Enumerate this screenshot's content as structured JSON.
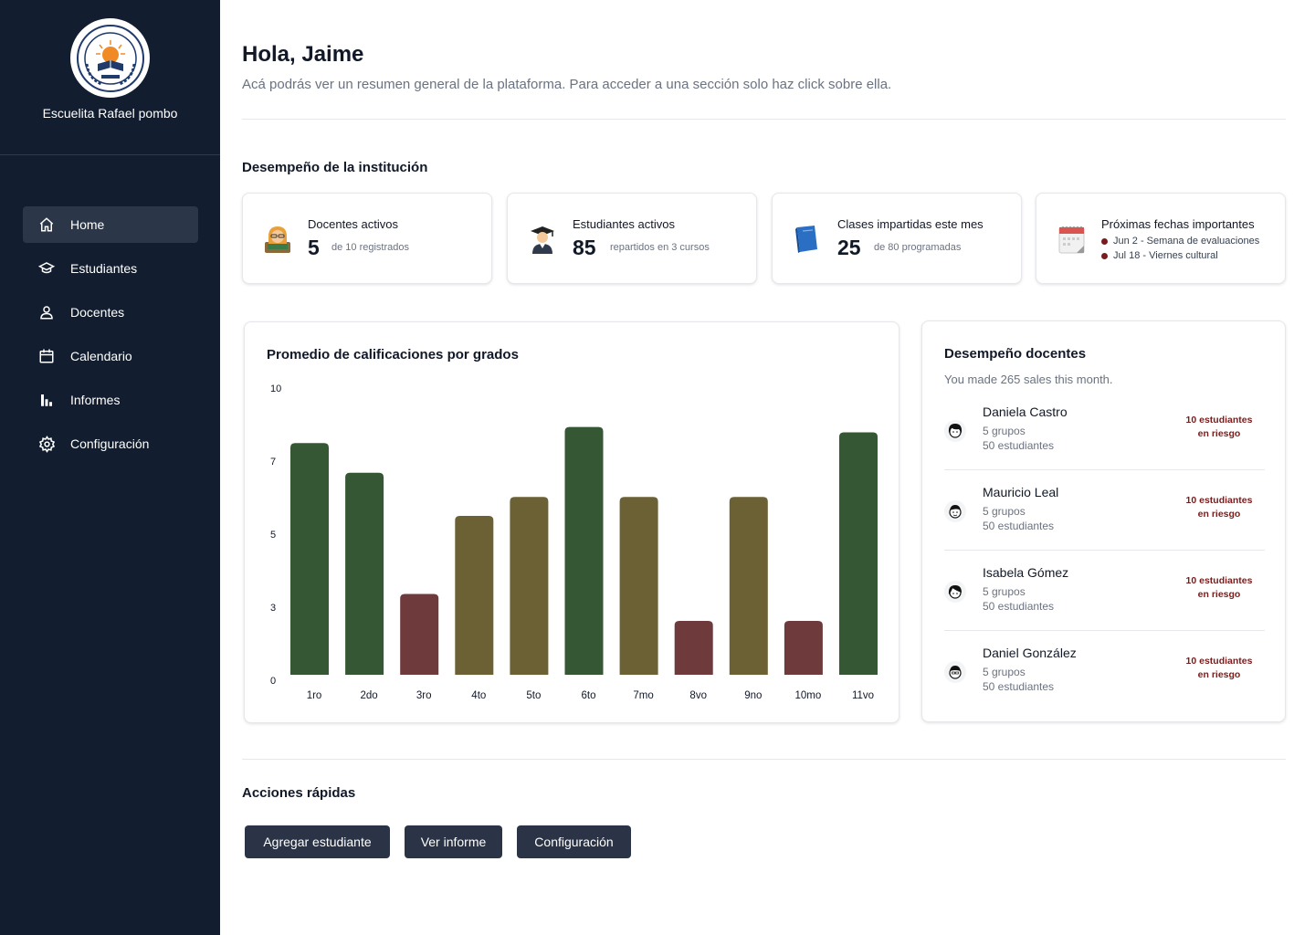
{
  "sidebar": {
    "school_name": "Escuelita Rafael pombo",
    "items": [
      {
        "label": "Home",
        "icon": "home-icon",
        "active": true
      },
      {
        "label": "Estudiantes",
        "icon": "graduation-cap-icon",
        "active": false
      },
      {
        "label": "Docentes",
        "icon": "user-icon",
        "active": false
      },
      {
        "label": "Calendario",
        "icon": "calendar-icon",
        "active": false
      },
      {
        "label": "Informes",
        "icon": "bar-chart-icon",
        "active": false
      },
      {
        "label": "Configuración",
        "icon": "gear-icon",
        "active": false
      }
    ]
  },
  "header": {
    "greeting": "Hola, Jaime",
    "subtitle": "Acá podrás ver un resumen general de la plataforma. Para acceder a una sección solo haz click sobre ella."
  },
  "performance": {
    "title": "Desempeño de la institución",
    "cards": [
      {
        "title": "Docentes activos",
        "value": "5",
        "note": "de 10 registrados",
        "icon": "teacher-icon"
      },
      {
        "title": "Estudiantes activos",
        "value": "85",
        "note": "repartidos en 3 cursos",
        "icon": "student-icon"
      },
      {
        "title": "Clases impartidas este mes",
        "value": "25",
        "note": "de 80 programadas",
        "icon": "book-icon"
      },
      {
        "title": "Próximas fechas importantes",
        "dates": [
          "Jun 2 - Semana de evaluaciones",
          "Jul 18 - Viernes cultural"
        ],
        "icon": "calendar-pad-icon"
      }
    ]
  },
  "chart_data": {
    "type": "bar",
    "title": "Promedio de calificaciones por grados",
    "xlabel": "",
    "ylabel": "",
    "ylim": [
      0,
      10
    ],
    "y_ticks": [
      "0",
      "3",
      "5",
      "7",
      "10"
    ],
    "categories": [
      "1ro",
      "2do",
      "3ro",
      "4to",
      "5to",
      "6to",
      "7mo",
      "8vo",
      "9no",
      "10mo",
      "11vo"
    ],
    "values": [
      8.6,
      7.5,
      3.0,
      5.9,
      6.6,
      9.2,
      6.6,
      2.0,
      6.6,
      2.0,
      9.0
    ],
    "colors": [
      "#365734",
      "#365734",
      "#6e3a3b",
      "#6c6134",
      "#6c6134",
      "#365734",
      "#6c6134",
      "#6e3a3b",
      "#6c6134",
      "#6e3a3b",
      "#365734"
    ],
    "grid": false
  },
  "teachers": {
    "title": "Desempeño docentes",
    "subtitle": "You made 265 sales this month.",
    "items": [
      {
        "name": "Daniela Castro",
        "groups": "5 grupos",
        "students": "50 estudiantes",
        "risk_line1": "10 estudiantes",
        "risk_line2": "en riesgo"
      },
      {
        "name": "Mauricio Leal",
        "groups": "5 grupos",
        "students": "50 estudiantes",
        "risk_line1": "10 estudiantes",
        "risk_line2": "en riesgo"
      },
      {
        "name": "Isabela Gómez",
        "groups": "5 grupos",
        "students": "50 estudiantes",
        "risk_line1": "10 estudiantes",
        "risk_line2": "en riesgo"
      },
      {
        "name": "Daniel González",
        "groups": "5 grupos",
        "students": "50 estudiantes",
        "risk_line1": "10 estudiantes",
        "risk_line2": "en riesgo"
      }
    ]
  },
  "quick_actions": {
    "title": "Acciones rápidas",
    "buttons": [
      "Agregar estudiante",
      "Ver informe",
      "Configuración"
    ]
  },
  "colors": {
    "sidebar_bg": "#121e2f",
    "active_nav": "#2b3749",
    "button_bg": "#2b3446",
    "risk": "#7a1c1c"
  }
}
